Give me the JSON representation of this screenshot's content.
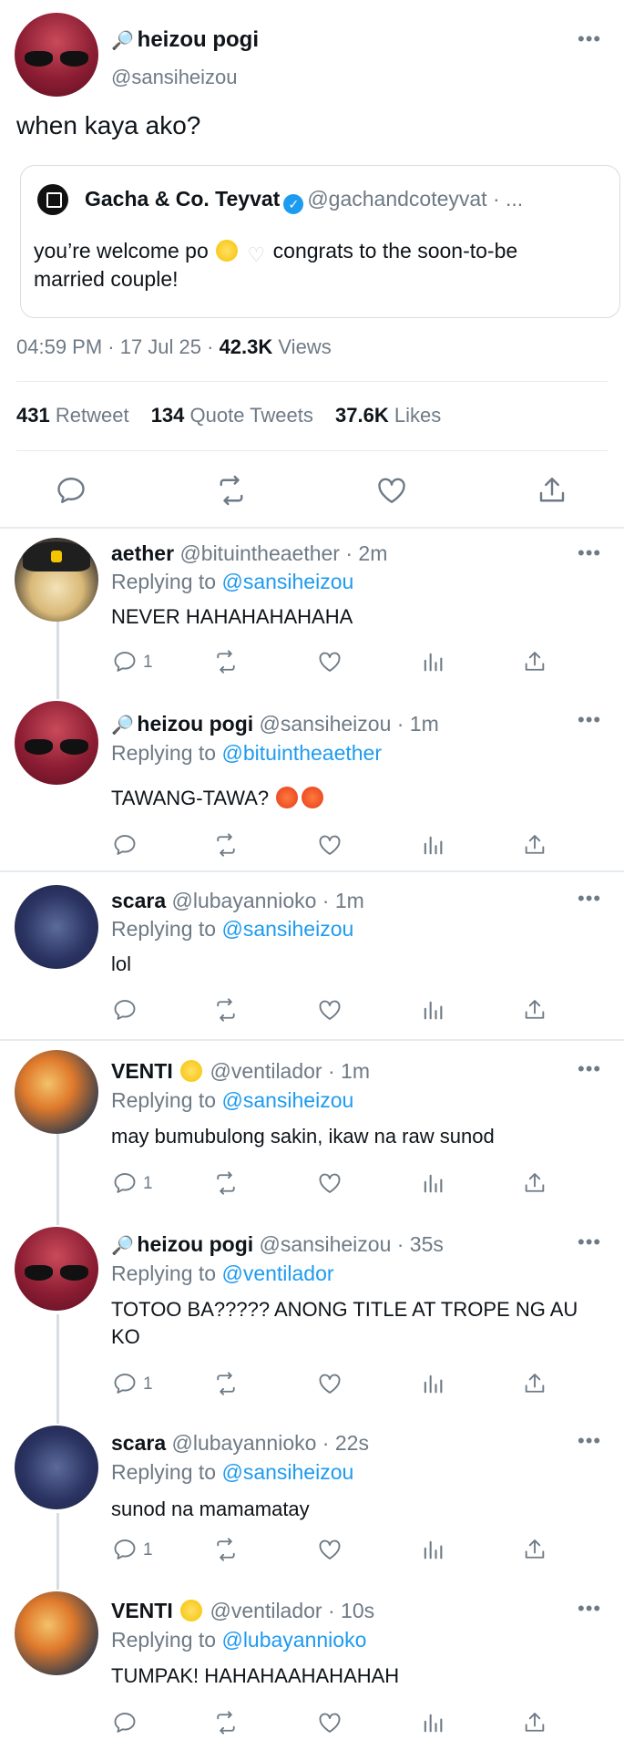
{
  "main_tweet": {
    "name": "heizou pogi",
    "name_prefix_icon": "magnifier-icon",
    "handle": "@sansiheizou",
    "text": "when kaya ako?",
    "quote": {
      "name": "Gacha & Co. Teyvat",
      "handle": "@gachandcoteyvat · ...",
      "text_a": "you’re welcome po",
      "text_b": "congrats to the soon-to-be married couple!"
    },
    "meta": {
      "time": "04:59 PM · 17 Jul 25 · ",
      "views_count": "42.3K",
      "views_label": "Views"
    },
    "stats": {
      "retweets": "431",
      "retweets_label": "Retweet",
      "quotes": "134",
      "quotes_label": "Quote Tweets",
      "likes": "37.6K",
      "likes_label": "Likes"
    }
  },
  "replies": [
    {
      "name": "aether",
      "handle": "@bituintheaether · 2m",
      "replying_label": "Replying to",
      "replying_to": "@sansiheizou",
      "text": "NEVER HAHAHAHAHAHA",
      "reply_count": "1"
    },
    {
      "name": "heizou pogi",
      "handle": "@sansiheizou · 1m",
      "replying_label": "Replying to",
      "replying_to": "@bituintheaether",
      "text": "TAWANG-TAWA?",
      "reply_count": ""
    },
    {
      "name": "scara",
      "handle": "@lubayannioko · 1m",
      "replying_label": "Replying to",
      "replying_to": "@sansiheizou",
      "text": "lol",
      "reply_count": ""
    },
    {
      "name": "VENTI",
      "handle": "@ventilador · 1m",
      "replying_label": "Replying to",
      "replying_to": "@sansiheizou",
      "text": "may bumubulong sakin, ikaw na raw sunod",
      "reply_count": "1"
    },
    {
      "name": "heizou pogi",
      "handle": "@sansiheizou · 35s",
      "replying_label": "Replying to",
      "replying_to": "@ventilador",
      "text": "TOTOO BA????? ANONG TITLE AT TROPE NG AU KO",
      "reply_count": "1"
    },
    {
      "name": "scara",
      "handle": "@lubayannioko · 22s",
      "replying_label": "Replying to",
      "replying_to": "@sansiheizou",
      "text": "sunod na mamamatay",
      "reply_count": "1"
    },
    {
      "name": "VENTI",
      "handle": "@ventilador · 10s",
      "replying_label": "Replying to",
      "replying_to": "@lubayannioko",
      "text": "TUMPAK! HAHAHAAHAHAHAH",
      "reply_count": ""
    }
  ],
  "icons": [
    "reply-icon",
    "retweet-icon",
    "like-icon",
    "analytics-icon",
    "share-icon",
    "more-icon",
    "verified-icon"
  ]
}
